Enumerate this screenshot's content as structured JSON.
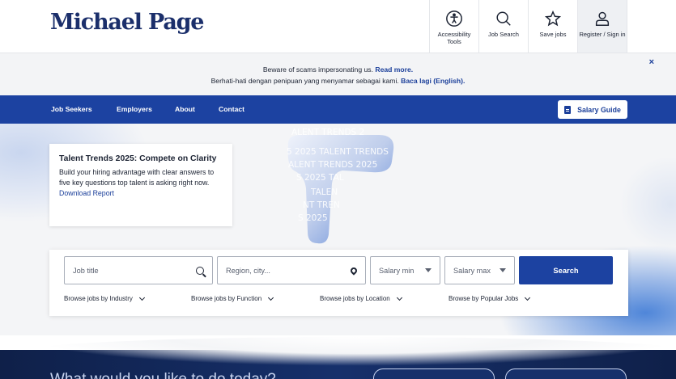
{
  "header": {
    "logo": "Michael Page",
    "util": [
      {
        "label": "Accessibility Tools",
        "icon": "accessibility-icon"
      },
      {
        "label": "Job Search",
        "icon": "search-icon"
      },
      {
        "label": "Save jobs",
        "icon": "star-icon"
      },
      {
        "label": "Register / Sign in",
        "icon": "user-icon"
      }
    ]
  },
  "banner": {
    "line1_text": "Beware of scams impersonating us.",
    "line1_link": "Read more.",
    "line2_text": "Berhati-hati dengan penipuan yang menyamar sebagai kami.",
    "line2_link": "Baca lagi (English).",
    "close": "×"
  },
  "nav": {
    "items": [
      "Job Seekers",
      "Employers",
      "About",
      "Contact"
    ],
    "salary_guide": "Salary Guide"
  },
  "promo": {
    "title": "Talent Trends 2025: Compete on Clarity",
    "text": "Build your hiring advantage with clear answers to five key questions top talent is asking right now.",
    "link": "Download Report"
  },
  "hero_art": {
    "words": [
      "ALENT TRENDS 2",
      "5 2025 TALENT TRENDS",
      "ALENT TRENDS 2025",
      "S 2025 TAL",
      "TALEN",
      "NT TREN",
      "S 2025"
    ]
  },
  "search": {
    "job_placeholder": "Job title",
    "region_placeholder": "Region, city...",
    "salary_min": "Salary min",
    "salary_max": "Salary max",
    "button": "Search",
    "browse": [
      "Browse jobs by Industry",
      "Browse jobs by Function",
      "Browse jobs by Location",
      "Browse by Popular Jobs"
    ]
  },
  "bottom": {
    "question": "What would you like to do today?"
  },
  "colors": {
    "brand_blue": "#1c42a1",
    "logo_navy": "#1b2f6b",
    "link_blue": "#1b3f9a"
  }
}
